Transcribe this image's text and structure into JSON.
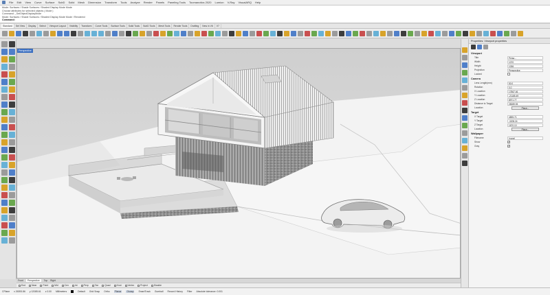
{
  "menu": {
    "items": [
      "File",
      "Edit",
      "View",
      "Curve",
      "Surface",
      "SubD",
      "Solid",
      "Mesh",
      "Dimension",
      "Transform",
      "Tools",
      "Analyze",
      "Render",
      "Panels",
      "Paneling Tools",
      "Toomanotics 2020",
      "Lumion",
      "V-Ray",
      "VisualARQ",
      "Help"
    ]
  },
  "command_history": {
    "lines": [
      "Mode: Surfaces / Shade Surfaces / Shaded Display Mode Mode",
      "Choose attributes for selected objects ( Mode )",
      "Command: _SetObjectDisplayMode",
      "Mode: Surfaces / Shade Surfaces / Shaded Display Mode Mode / Rendered"
    ],
    "command_label": "Command:"
  },
  "tabs": [
    "Standard",
    "Set View",
    "Display",
    "Select",
    "Viewport Layout",
    "Visibility",
    "Transform",
    "Curve Tools",
    "Surface Tools",
    "Solid Tools",
    "SubD Tools",
    "Mesh Tools",
    "Render Tools",
    "Drafting",
    "New in V6",
    "V7"
  ],
  "viewport": {
    "title": "Perspective"
  },
  "viewport_tabs": [
    "Front",
    "Perspective",
    "Top",
    "Right"
  ],
  "osnap": [
    "End",
    "Near",
    "Point",
    "Mid",
    "Cen",
    "Int",
    "Perp",
    "Tan",
    "Quad",
    "Knot",
    "Vertex",
    "Project",
    "Disable"
  ],
  "status": {
    "cplane": "CPlane",
    "x": "x 26393.86",
    "y": "y 12085.61",
    "z": "z 0.00",
    "units": "Millimeters",
    "layer": "Default",
    "toggles": [
      "Grid Snap",
      "Ortho",
      "Planar",
      "Osnap",
      "SmartTrack",
      "Gumball",
      "Record History",
      "Filter",
      "Absolute tolerance: 0.001"
    ]
  },
  "properties": {
    "title": "Properties: Viewport properties",
    "viewport_section": "Viewport",
    "viewport_rows": [
      {
        "key": "Title",
        "value": "Persp..."
      },
      {
        "key": "Width",
        "value": "1070"
      },
      {
        "key": "Height",
        "value": "1036"
      },
      {
        "key": "Projection",
        "value": "Perspective"
      }
    ],
    "locked_label": "Locked",
    "camera_section": "Camera",
    "camera_rows": [
      {
        "key": "Lens Length(mm)",
        "value": "50.0"
      },
      {
        "key": "Rotation",
        "value": "0.0"
      },
      {
        "key": "X Location",
        "value": "17867.46"
      },
      {
        "key": "Y Location",
        "value": "-21185.49"
      },
      {
        "key": "Z Location",
        "value": "8971.77"
      },
      {
        "key": "Distance to Target",
        "value": "28289.93"
      }
    ],
    "location_label": "Location",
    "place_label": "Place...",
    "target_section": "Target",
    "target_rows": [
      {
        "key": "X Target",
        "value": "4895.71"
      },
      {
        "key": "Y Target",
        "value": "-3205.24"
      },
      {
        "key": "Z Target",
        "value": "1670.10"
      }
    ],
    "wallpaper_section": "Wallpaper",
    "wallpaper_rows": [
      {
        "key": "Filename",
        "value": "(none)"
      }
    ],
    "show_label": "Show",
    "gray_label": "Gray"
  },
  "colors": {
    "viewport_bg": "#e1e1e1",
    "title_accent": "#3b6fc1"
  }
}
